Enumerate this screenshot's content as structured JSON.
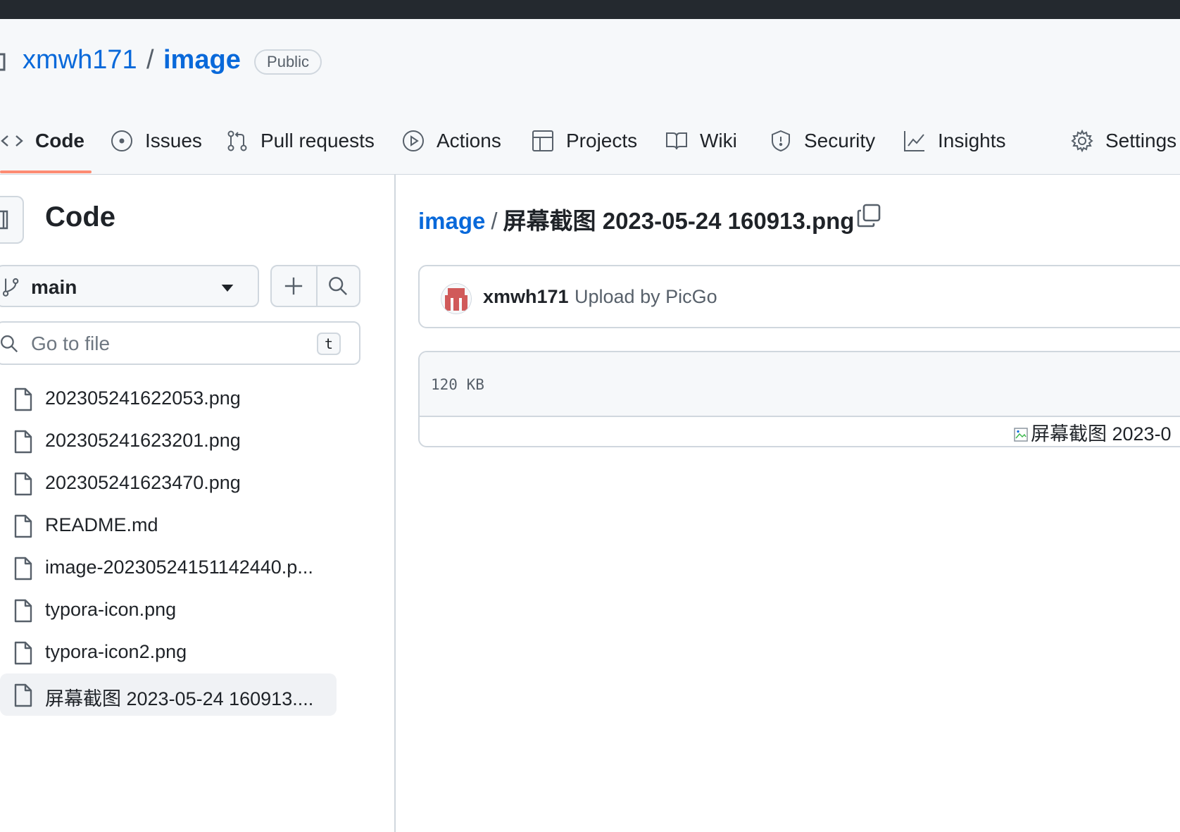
{
  "repo": {
    "owner": "xmwh171",
    "separator": "/",
    "name": "image",
    "visibility": "Public"
  },
  "tabs": [
    {
      "label": "Code",
      "icon": "code-icon",
      "active": true
    },
    {
      "label": "Issues",
      "icon": "issue-opened-icon"
    },
    {
      "label": "Pull requests",
      "icon": "git-pull-request-icon"
    },
    {
      "label": "Actions",
      "icon": "play-icon"
    },
    {
      "label": "Projects",
      "icon": "table-icon"
    },
    {
      "label": "Wiki",
      "icon": "book-icon"
    },
    {
      "label": "Security",
      "icon": "shield-icon"
    },
    {
      "label": "Insights",
      "icon": "graph-icon"
    },
    {
      "label": "Settings",
      "icon": "gear-icon"
    }
  ],
  "sidebar": {
    "title": "Code",
    "branch": "main",
    "goto_placeholder": "Go to file",
    "goto_shortcut": "t",
    "files": [
      {
        "name": "202305241622053.png"
      },
      {
        "name": "202305241623201.png"
      },
      {
        "name": "202305241623470.png"
      },
      {
        "name": "README.md"
      },
      {
        "name": "image-20230524151142440.p..."
      },
      {
        "name": "typora-icon.png"
      },
      {
        "name": "typora-icon2.png"
      },
      {
        "name": "屏幕截图 2023-05-24 160913....",
        "selected": true
      }
    ]
  },
  "breadcrumb": {
    "repo": "image",
    "separator": "/",
    "file": "屏幕截图 2023-05-24 160913.png"
  },
  "commit": {
    "user": "xmwh171",
    "message": "Upload by PicGo"
  },
  "blob": {
    "size": "120 KB",
    "image_alt": "屏幕截图 2023-0"
  },
  "colors": {
    "link": "#0969da",
    "tab_underline": "#fd8c73",
    "border": "#d0d7de",
    "header_bg": "#f6f8fa",
    "topbar": "#24292f"
  }
}
